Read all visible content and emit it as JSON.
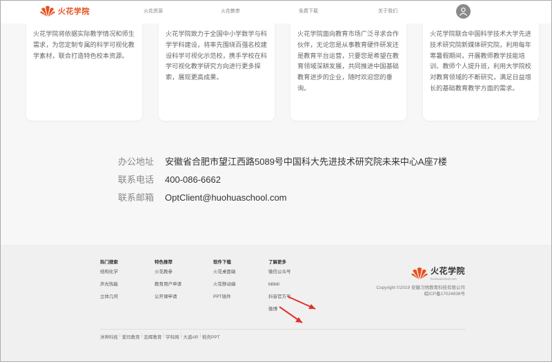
{
  "header": {
    "brand": "火花学院",
    "nav": [
      "火花资源",
      "火花教参",
      "免费下载",
      "关于我们"
    ]
  },
  "cards": [
    "火花学院将依据实际教学情况和师生需求，为您定制专属的科学可视化教学素材，联合打造特色校本资源。",
    "火花学院致力于全国中小学数学与科学学科建设，将率先围绕百强名校建设科学可视化示范校，携手学校在科学可视化教学研究方向进行更多探索，展现更高成果。",
    "火花学院面向教育市场广泛寻求合作伙伴，无论您是从事教育硬件研发还是教育平台运营，只要您是希望在教育领域深耕发展，共同推进中国基础教育进步的企业，随时欢迎您的垂询。",
    "火花学院联合中国科学技术大学先进技术研究院新媒体研究院，利用每年寒暑假期间，开展教师教学技能培训、教师个人提升班，利用大学院校对教育领域的不断研究，满足日益增长的基础教育教学方面的需求。"
  ],
  "contact": {
    "address_label": "办公地址",
    "address": "安徽省合肥市望江西路5089号中国科大先进技术研究院未来中心A座7楼",
    "phone_label": "联系电话",
    "phone": "400-086-6662",
    "email_label": "联系邮箱",
    "email": "OptClient@huohuaschool.com"
  },
  "footer": {
    "columns": [
      {
        "title": "热门搜索",
        "items": [
          "结构化学",
          "声光热能",
          "立体几何"
        ]
      },
      {
        "title": "特色推荐",
        "items": [
          "火花教参",
          "教育用户申请",
          "公开课申请"
        ]
      },
      {
        "title": "软件下载",
        "items": [
          "火花桌面端",
          "火花移动端",
          "PPT插件"
        ]
      },
      {
        "title": "了解更多",
        "items": [
          "微信公众号",
          "bilibili",
          "抖音官方号",
          "微博"
        ]
      }
    ],
    "brand": "火花学院",
    "brand_domain": "huohuaschool.com",
    "copyright": "Copyright ©2019 安徽习悦教育科技有限公司",
    "icp": "皖ICP备17024836号",
    "links": [
      "沐神科技",
      "爱玛教育",
      "志辉教育",
      "学科网",
      "大道AR",
      "稻壳PPT"
    ]
  },
  "colors": {
    "brand_orange": "#e8501e",
    "annotation_red": "#e0302a"
  }
}
